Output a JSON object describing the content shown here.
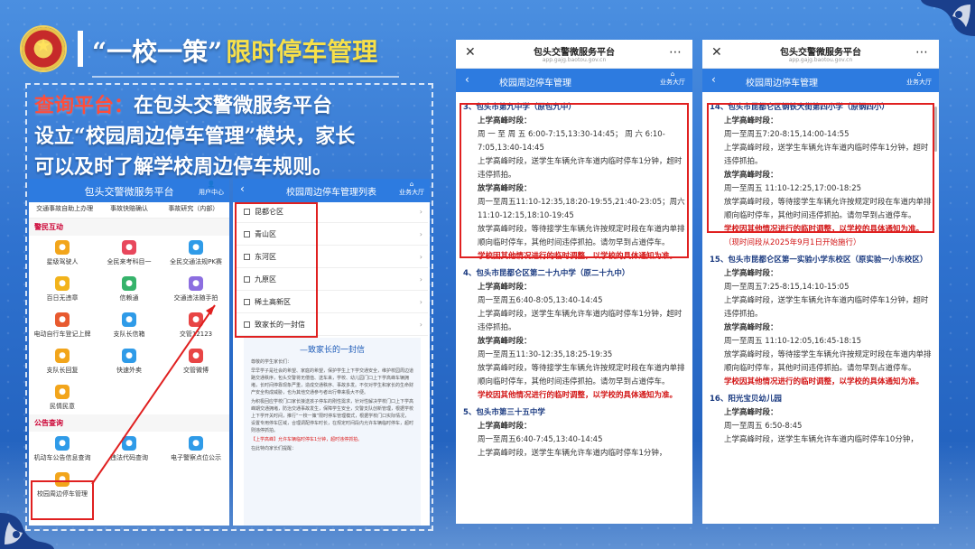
{
  "header": {
    "title_part1": "“一校一策”",
    "title_part2": "限时停车管理"
  },
  "intro": {
    "label": "查询平台：",
    "line1": "在包头交警微服务平台",
    "line2": "设立“校园周边停车管理”模块，家长",
    "line3": "可以及时了解学校周边停车规则。"
  },
  "phone1": {
    "title": "包头交警微服务平台",
    "user_center": "用户中心",
    "top_items": [
      "交通事故自助上办理",
      "事故快赔确认",
      "事故研究（内部）"
    ],
    "sections": [
      {
        "name": "警民互动",
        "items": [
          {
            "label": "星级驾驶人",
            "color": "#f2a51b"
          },
          {
            "label": "全民来考科目一",
            "color": "#e8475c"
          },
          {
            "label": "全民交通法规PK赛",
            "color": "#2f9be8"
          },
          {
            "label": "百日无违章",
            "color": "#f2b31b"
          },
          {
            "label": "信赖通",
            "color": "#36b36b"
          },
          {
            "label": "交通违法随手拍",
            "color": "#8c6ee0"
          },
          {
            "label": "电动自行车登记上牌",
            "color": "#e85a2f"
          },
          {
            "label": "支队长信箱",
            "color": "#2f9be8"
          },
          {
            "label": "交管12123",
            "color": "#e84545"
          },
          {
            "label": "支队长回复",
            "color": "#f2a51b"
          },
          {
            "label": "快速外卖",
            "color": "#2f9be8"
          },
          {
            "label": "交管微博",
            "color": "#e84545"
          },
          {
            "label": "民情民意",
            "color": "#f2a51b"
          }
        ]
      },
      {
        "name": "公告查询",
        "items": [
          {
            "label": "机动车公告信息查询",
            "color": "#2f9be8"
          },
          {
            "label": "违法代码查询",
            "color": "#2f9be8"
          },
          {
            "label": "电子警察点位公示",
            "color": "#2f9be8"
          },
          {
            "label": "校园周边停车管理",
            "color": "#f2a51b"
          }
        ]
      }
    ]
  },
  "phone2": {
    "title": "校园周边停车管理列表",
    "hall": "业务大厅",
    "districts": [
      "昆都仑区",
      "青山区",
      "东河区",
      "九原区",
      "稀土高新区",
      "致家长的一封信"
    ],
    "letter_title": "—致家长的一封信",
    "letter_greeting": "尊敬的学生家长们：",
    "letter_p1": "早早学子是社会的希望、家庭的希望，保护学生上下学交通安全，维护校园周边道路交通秩序，包头交警将无偿值、送车来，学校、幼儿园门口上下学高峰车辆拥堵，长时间停靠现象严重，造成交通秩序、事故多发。不仅对学生和家长的生命财产安全构成威胁，也为其他交通参与者出行带来极大不便。",
    "letter_p2": "为积极回应学校门口家长接送孩子停车的刚性需求，针对性解决学校门口上下学高峰期交通拥堵，防治交通事故发生，保障学生安全，交警支队创新管理，根据学校上下学开关时间，推行“一校一策”限时停车管理模式，根据学校门口实际情况，设置专用停车区域，合理调配停车时长，在规定时间段内允许车辆临时停车，超时则违停抓拍。",
    "letter_p3": "【上学高峰】允许车辆临时停车1分钟，超时违停抓拍。",
    "letter_p4": "在此特向家长们提醒："
  },
  "phone_common": {
    "app_title": "包头交警微服务平台",
    "app_url": "app.gajg.baotou.gov.cn",
    "nav_title": "校园周边停车管理",
    "hall": "业务大厅"
  },
  "phone3": {
    "schools": [
      {
        "name": "3、包头市第九中学（原包九中）",
        "am_label": "上学高峰时段：",
        "am_time": "周 一 至 周 五 6:00-7:15,13:30-14:45； 周 六 6:10-7:05,13:40-14:45",
        "am_rule": "上学高峰时段，送学生车辆允许车道内临时停车1分钟，超时违停抓拍。",
        "pm_label": "放学高峰时段：",
        "pm_time": "周一至周五11:10-12:35,18:20-19:55,21:40-23:05；周六11:10-12:15,18:10-19:45",
        "pm_rule": "放学高峰时段，等待接学生车辆允许按规定时段在车道内单排顺向临时停车，其他时间违停抓拍。请勿早到占道停车。",
        "note": "学校因其他情况进行的临时调整，以学校的具体通知为准。"
      },
      {
        "name": "4、包头市昆都仑区第二十九中学（原二十九中）",
        "am_label": "上学高峰时段：",
        "am_time": "周一至周五6:40-8:05,13:40-14:45",
        "am_rule": "上学高峰时段，送学生车辆允许车道内临时停车1分钟，超时违停抓拍。",
        "pm_label": "放学高峰时段：",
        "pm_time": "周一至周五11:30-12:35,18:25-19:35",
        "pm_rule": "放学高峰时段，等待接学生车辆允许按规定时段在车道内单排顺向临时停车，其他时间违停抓拍。请勿早到占道停车。",
        "note": "学校因其他情况进行的临时调整，以学校的具体通知为准。"
      },
      {
        "name": "5、包头市第三十五中学",
        "am_label": "上学高峰时段：",
        "am_time": "周一至周五6:40-7:45,13:40-14:45",
        "am_rule": "上学高峰时段，送学生车辆允许车道内临时停车1分钟，"
      }
    ]
  },
  "phone4": {
    "schools": [
      {
        "name": "14、包头市昆都仑区钢铁大街第四小学（原钢四小）",
        "am_label": "上学高峰时段：",
        "am_time": "周一至周五7:20-8:15,14:00-14:55",
        "am_rule": "上学高峰时段，送学生车辆允许车道内临时停车1分钟，超时违停抓拍。",
        "pm_label": "放学高峰时段：",
        "pm_time": "周一至周五 11:10-12:25,17:00-18:25",
        "pm_rule": "放学高峰时段，等待接学生车辆允许按规定时段在车道内单排顺向临时停车，其他时间违停抓拍。请勿早到占道停车。",
        "note": "学校因其他情况进行的临时调整，以学校的具体通知为准。",
        "effective": "（现时间段从2025年9月1日开始施行）"
      },
      {
        "name": "15、包头市昆都仑区第一实验小学东校区（原实验一小东校区）",
        "am_label": "上学高峰时段：",
        "am_time": "周一至周五7:25-8:15,14:10-15:05",
        "am_rule": "上学高峰时段，送学生车辆允许车道内临时停车1分钟，超时违停抓拍。",
        "pm_label": "放学高峰时段：",
        "pm_time": "周一至周五 11:10-12:05,16:45-18:15",
        "pm_rule": "放学高峰时段，等待接学生车辆允许按规定时段在车道内单排顺向临时停车，其他时间违停抓拍。请勿早到占道停车。",
        "note": "学校因其他情况进行的临时调整，以学校的具体通知为准。"
      },
      {
        "name": "16、阳光宝贝幼儿园",
        "am_label": "上学高峰时段：",
        "am_time": "周一至周五 6:50-8:45",
        "am_rule": "上学高峰时段，送学生车辆允许车道内临时停车10分钟，"
      }
    ]
  },
  "colors": {
    "accent_blue": "#2d7be0",
    "highlight_red": "#e02020",
    "title_yellow": "#f7e04a"
  }
}
